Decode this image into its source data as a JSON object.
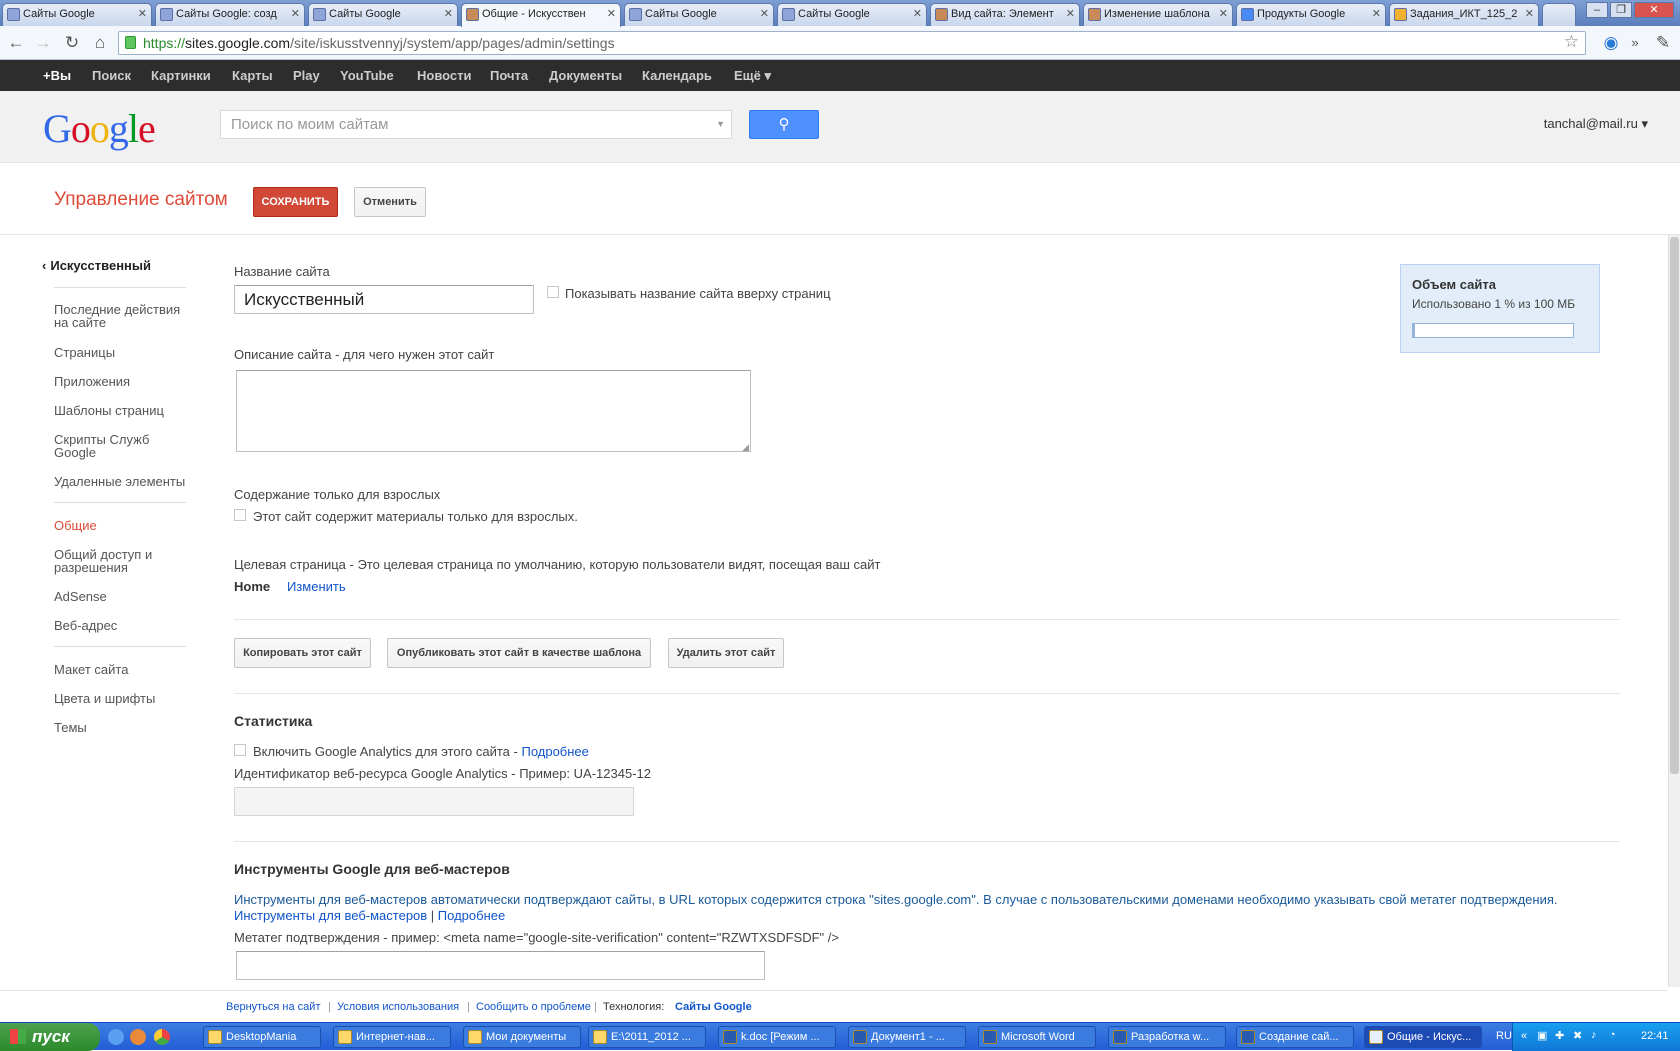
{
  "tabs": [
    {
      "label": "Сайты Google"
    },
    {
      "label": "Сайты Google: созд"
    },
    {
      "label": "Сайты Google"
    },
    {
      "label": "Общие - Искусствен"
    },
    {
      "label": "Сайты Google"
    },
    {
      "label": "Сайты Google"
    },
    {
      "label": "Вид сайта: Элемент"
    },
    {
      "label": "Изменение шаблона"
    },
    {
      "label": "Продукты Google"
    },
    {
      "label": "Задания_ИКТ_125_2"
    }
  ],
  "address": {
    "scheme": "https://",
    "host": "sites.google.com",
    "path": "/site/iskusstvennyj/system/app/pages/admin/settings"
  },
  "blackbar": [
    "+Вы",
    "Поиск",
    "Картинки",
    "Карты",
    "Play",
    "YouTube",
    "Новости",
    "Почта",
    "Документы",
    "Календарь",
    "Ещё ▾"
  ],
  "header": {
    "search_placeholder": "Поиск по моим сайтам",
    "user": "tanchal@mail.ru ▾"
  },
  "mgmt": {
    "title": "Управление сайтом",
    "save": "СОХРАНИТЬ",
    "cancel": "Отменить"
  },
  "sidebar": {
    "back": "Искусственный",
    "group1": [
      "Последние действия на сайте",
      "Страницы",
      "Приложения",
      "Шаблоны страниц",
      "Скрипты Служб Google",
      "Удаленные элементы"
    ],
    "group2": [
      "Общие",
      "Общий доступ и разрешения",
      "AdSense",
      "Веб-адрес"
    ],
    "group3": [
      "Макет сайта",
      "Цвета и шрифты",
      "Темы"
    ]
  },
  "form": {
    "name_label": "Название сайта",
    "name_value": "Искусственный",
    "show_name_label": "Показывать название сайта вверху страниц",
    "desc_label": "Описание сайта - для чего нужен этот сайт",
    "adult_heading": "Содержание только для взрослых",
    "adult_label": "Этот сайт содержит материалы только для взрослых.",
    "landing_label": "Целевая страница - Это целевая страница по умолчанию, которую пользователи видят, посещая ваш сайт",
    "landing_value": "Home",
    "landing_change": "Изменить",
    "copy_btn": "Копировать этот сайт",
    "publish_btn": "Опубликовать этот сайт в качестве шаблона",
    "delete_btn": "Удалить этот сайт",
    "stats_heading": "Статистика",
    "ga_label": "Включить Google Analytics для этого сайта - ",
    "ga_more": "Подробнее",
    "ga_id_label": "Идентификатор веб-ресурса Google Analytics - Пример: UA-12345-12",
    "wm_heading": "Инструменты Google для веб-мастеров",
    "wm_text": "Инструменты для веб-мастеров автоматически подтверждают сайты, в URL которых содержится строка \"sites.google.com\". В случае с пользовательскими доменами необходимо указывать свой метатег подтверждения.",
    "wm_link1": "Инструменты для веб-мастеров",
    "wm_sep": " | ",
    "wm_link2": "Подробнее",
    "meta_label": "Метатег подтверждения - пример: <meta name=\"google-site-verification\" content=\"RZWTXSDFSDF\" />"
  },
  "quota": {
    "title": "Объем сайта",
    "usage": "Использовано 1 % из 100 МБ",
    "percent": 1
  },
  "footer": {
    "back": "Вернуться на сайт",
    "terms": "Условия использования",
    "report": "Сообщить о проблеме",
    "tech_label": "Технология:",
    "tech_value": "Сайты Google"
  },
  "taskbar": {
    "start": "пуск",
    "items": [
      "DesktopMania",
      "Интернет-нав...",
      "Мои документы",
      "E:\\2011_2012 ...",
      "k.doc [Режим ...",
      "Документ1 - ...",
      "Microsoft Word",
      "Разработка w...",
      "Создание сай...",
      "Общие - Искус..."
    ],
    "lang": "RU",
    "time": "22:41"
  }
}
